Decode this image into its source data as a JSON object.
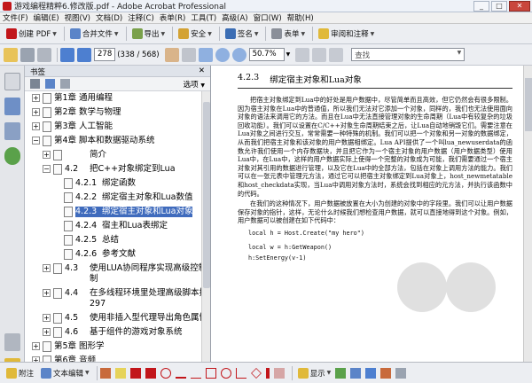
{
  "window": {
    "title": "游戏编程精粹6.修改版.pdf - Adobe Acrobat Professional",
    "min": "_",
    "max": "□",
    "close": "✕"
  },
  "menu": [
    "文件(F)",
    "编辑(E)",
    "视图(V)",
    "文档(D)",
    "注释(C)",
    "表单(R)",
    "工具(T)",
    "高级(A)",
    "窗口(W)",
    "帮助(H)"
  ],
  "toolbar1": {
    "create": "创建 PDF",
    "combine": "合并文件",
    "export": "导出",
    "secure": "安全",
    "sign": "签名",
    "forms": "表单",
    "review": "审阅和注释"
  },
  "toolbar2": {
    "page_current": "278",
    "page_count": "(338 / 568)",
    "zoom": "50.7%",
    "search_placeholder": "查找"
  },
  "bookmarks": {
    "header": "书签",
    "options": "选项",
    "items": [
      {
        "level": 0,
        "exp": "+",
        "num": "第1章",
        "label": "通用编程"
      },
      {
        "level": 0,
        "exp": "+",
        "num": "第2章",
        "label": "数学与物理"
      },
      {
        "level": 0,
        "exp": "+",
        "num": "第3章",
        "label": "人工智能"
      },
      {
        "level": 0,
        "exp": "−",
        "num": "第4章",
        "label": "脚本和数据驱动系统"
      },
      {
        "level": 1,
        "exp": "+",
        "num": "",
        "label": "简介"
      },
      {
        "level": 1,
        "exp": "−",
        "num": "4.2",
        "label": "把C++对象绑定到Lua"
      },
      {
        "level": 2,
        "exp": "",
        "num": "4.2.1",
        "label": "绑定函数"
      },
      {
        "level": 2,
        "exp": "",
        "num": "4.2.2",
        "label": "绑定宿主对象和Lua数值"
      },
      {
        "level": 2,
        "exp": "",
        "num": "4.2.3",
        "label": "绑定宿主对象和Lua对象",
        "selected": true
      },
      {
        "level": 2,
        "exp": "",
        "num": "4.2.4",
        "label": "宿主和Lua表绑定"
      },
      {
        "level": 2,
        "exp": "",
        "num": "4.2.5",
        "label": "总结"
      },
      {
        "level": 2,
        "exp": "",
        "num": "4.2.6",
        "label": "参考文献"
      },
      {
        "level": 1,
        "exp": "+",
        "num": "4.3",
        "label": "使用LUA协同程序实现高级控制机制"
      },
      {
        "level": 1,
        "exp": "+",
        "num": "4.4",
        "label": "在多线程环境里处理高级脚本执行 297"
      },
      {
        "level": 1,
        "exp": "+",
        "num": "4.5",
        "label": "使用非插入型代理导出角色属性"
      },
      {
        "level": 1,
        "exp": "+",
        "num": "4.6",
        "label": "基于组件的游戏对象系统"
      },
      {
        "level": 0,
        "exp": "+",
        "num": "第5章",
        "label": "图形学"
      },
      {
        "level": 0,
        "exp": "+",
        "num": "第6章",
        "label": "音频"
      }
    ]
  },
  "document": {
    "section_num": "4.2.3",
    "section_title": "绑定宿主对象和Lua对象",
    "para1": "把宿主对象绑定到Lua中的好处是用户数据中，尽管简单而且高效，但它仍然会有很多限制。因为宿主对象在Lua中的普通值，所以我们无法对它添加一个对象，同样的，我们也无法使用面向对象的语法来调用它的方法。而且在Lua中无法直接管理对象的生命周期（Lua中有较复杂的垃圾回收功能）。我们可以设置在C/C++对象生命周期结束之后，让Lua自动地销毁它们。需要注意在Lua对象之间进行交互，常常需要一种特殊的机制。我们可以把一个对象和另一对象的数据绑定，从而我们把宿主对象和该对象的用户数据相绑定。Lua API提供了一个叫lua_newuserdata的函数允许我们使用一个内存数据块，并且把它作为一个宿主对象的用户数据（用户数据类型）使用Lua中，在Lua中，这样的用户数据实际上使得一个完整的对象成为可能，我们需要通过一个宿主对象对其引用的数据进行管理，以及它在Lua中的全部方法，包括在对象上调用方法的能力。我们可以在一张元表中管理元方法，通过它可以把宿主对象绑定到Lua对象上，host_newmetatable和host_checkdata实现，当Lua中调用对象方法时，系统会找到相应的元方法，并执行该函数中的代码。",
    "para2": "在我们的这种情况下，用户数据被放置在大小为创建的对象中的字段里。我们可以让用户数据保存对象的指针，这样，无论什么时候我们想检查用户数据，就可以直接地得到这个对象。例如，用户数据可以被创建在如下代码中：",
    "code1": "local h = Host.Create(\"my hero\")",
    "code2": "local w = h:GetWeapon()",
    "code3": "h:SetEnergy(v-1)"
  },
  "bottom": {
    "note": "附注",
    "textedit": "文本编辑",
    "show": "显示"
  },
  "colors": {
    "selection": "#3f6bbd",
    "acrobat_red": "#c2161b"
  }
}
